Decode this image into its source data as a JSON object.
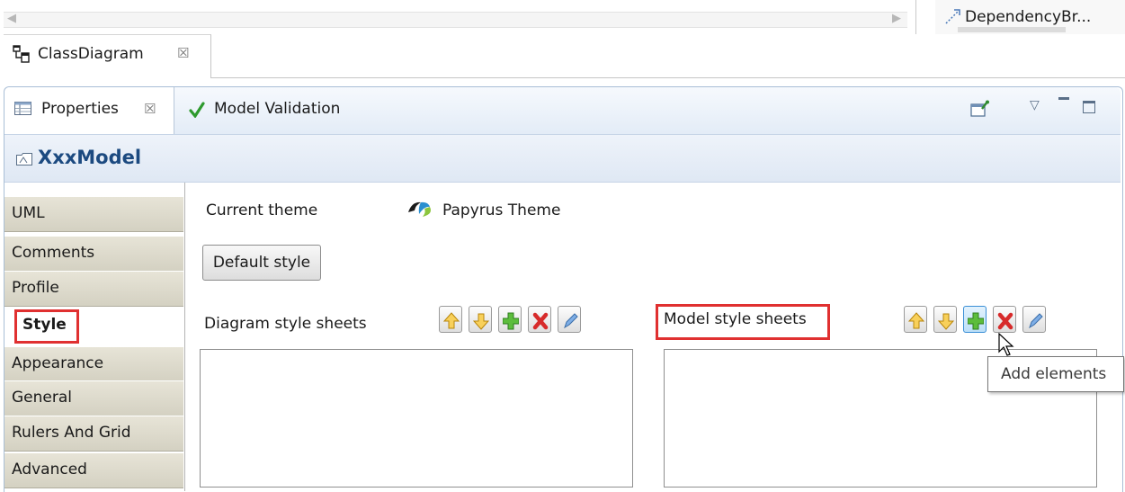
{
  "top": {
    "dependency_tab_label": "DependencyBr..."
  },
  "editor": {
    "tab_label": "ClassDiagram",
    "close_glyph": "☒"
  },
  "view": {
    "tabs": [
      {
        "label": "Properties",
        "icon": "properties-table-icon",
        "close_glyph": "☒"
      },
      {
        "label": "Model Validation",
        "icon": "green-check-icon"
      }
    ],
    "toolbar_icons": [
      "pin-view-icon",
      "view-menu-icon",
      "minimize-icon",
      "maximize-icon"
    ],
    "menu_glyph": "▽"
  },
  "title": {
    "text": "XxxModel",
    "icon": "model-folder-icon"
  },
  "left_tabs": [
    {
      "label": "UML"
    },
    {
      "label": "Comments"
    },
    {
      "label": "Profile"
    },
    {
      "label": "Style",
      "selected": true
    },
    {
      "label": "Appearance"
    },
    {
      "label": "General"
    },
    {
      "label": "Rulers And Grid"
    },
    {
      "label": "Advanced"
    }
  ],
  "style_page": {
    "current_theme_label": "Current theme",
    "theme_value": "Papyrus Theme",
    "default_style_button": "Default style",
    "diagram_stylesheets_label": "Diagram style sheets",
    "model_stylesheets_label": "Model style sheets",
    "list_buttons": [
      "move-up-icon",
      "move-down-icon",
      "add-icon",
      "remove-icon",
      "edit-icon"
    ],
    "tooltip": "Add elements"
  },
  "colors": {
    "highlight": "#e03030",
    "title_text": "#1c4a80",
    "view_border": "#a9bed6"
  }
}
